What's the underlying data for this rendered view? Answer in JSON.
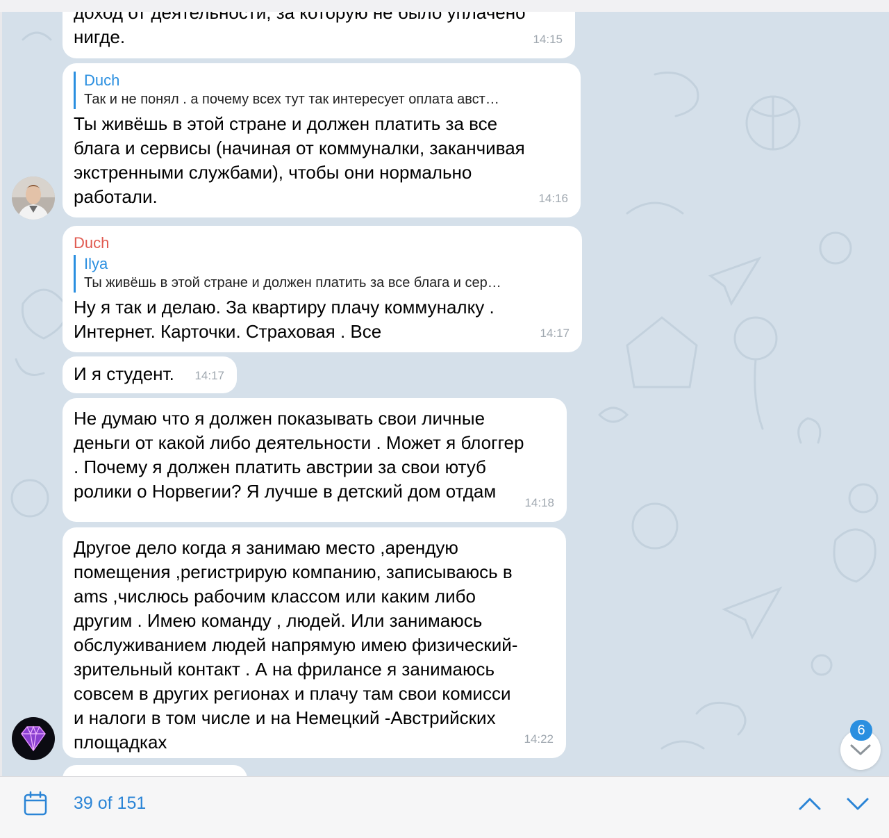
{
  "messages": {
    "m1": {
      "text": "доход от деятельности, за которую не было уплачено\nнигде.",
      "time": "14:15"
    },
    "m2": {
      "reply_name": "Duch",
      "reply_text": "Так и не понял . а почему всех тут так интересует оплата авст…",
      "text": "Ты живёшь в этой стране и должен платить за все\nблага и сервисы (начиная от коммуналки, заканчивая\nэкстренными службами), чтобы они нормально\nработали.",
      "time": "14:16"
    },
    "m3": {
      "sender": "Duch",
      "reply_name": "Ilya",
      "reply_text": "Ты живёшь в этой стране и должен платить за все блага и сер…",
      "text": "Ну я так и делаю. За квартиру плачу коммуналку .\nИнтернет. Карточки. Страховая . Все",
      "time": "14:17"
    },
    "m4": {
      "text": "И я студент.",
      "time": "14:17"
    },
    "m5": {
      "text": "Не думаю что я должен показывать свои личные\nденьги от какой либо деятельности . Может я блоггер\n. Почему я должен платить австрии за свои ютуб\nролики о Норвегии? Я лучше в детский дом отдам",
      "time": "14:18"
    },
    "m6": {
      "text": "Другое дело когда я занимаю место ,арендую\nпомещения ,регистрирую компанию, записываюсь в\nams ,числюсь рабочим классом или каким либо\nдругим . Имею команду , людей. Или занимаюсь\nобслуживанием людей напрямую имею физический-\nзрительный контакт . А на фрилансе я занимаюсь\nсовсем в других регионах и плачу там свои комисси\nи налоги в том числе и на Немецкий -Австрийских\nплощадках",
      "time": "14:22"
    }
  },
  "scroll_down": {
    "unread_count": "6"
  },
  "search_bar": {
    "counter": "39 of 151"
  },
  "icons": {
    "calendar": "calendar-icon",
    "up": "chevron-up-icon",
    "down": "chevron-down-icon",
    "scroll": "chevron-down-icon"
  },
  "colors": {
    "accent": "#2a84d6",
    "sender_name": "#e05a50",
    "chat_bg": "#d5e0ea",
    "badge": "#2a8fe0"
  }
}
